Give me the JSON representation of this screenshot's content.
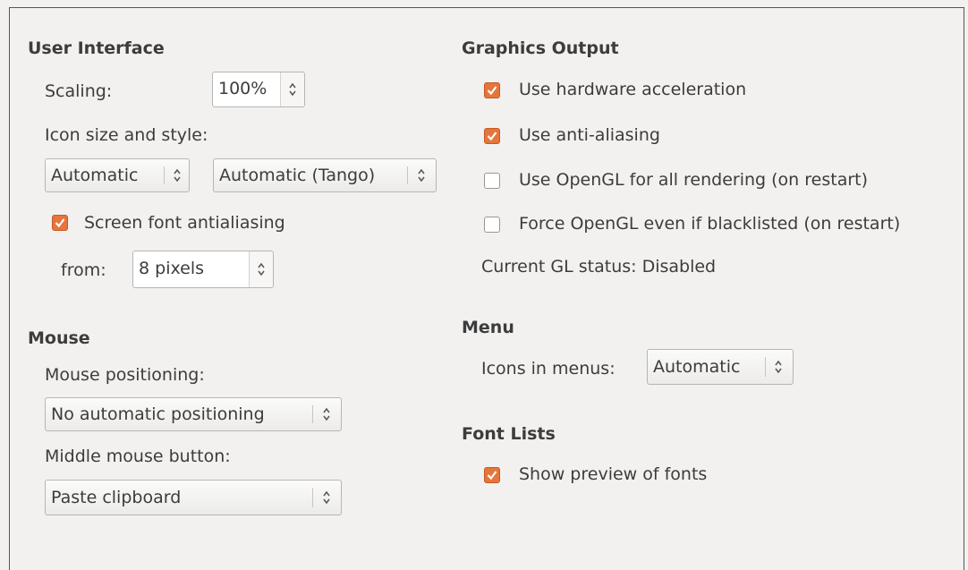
{
  "user_interface": {
    "heading": "User Interface",
    "scaling_label": "Scaling:",
    "scaling_value": "100%",
    "icon_label": "Icon size and style:",
    "icon_size_value": "Automatic",
    "icon_style_value": "Automatic (Tango)",
    "antialias_label": "Screen font antialiasing",
    "antialias_checked": true,
    "from_label": "from:",
    "from_value": "8 pixels"
  },
  "mouse": {
    "heading": "Mouse",
    "positioning_label": "Mouse positioning:",
    "positioning_value": "No automatic positioning",
    "middle_label": "Middle mouse button:",
    "middle_value": "Paste clipboard"
  },
  "graphics": {
    "heading": "Graphics Output",
    "hw_accel_label": "Use hardware acceleration",
    "hw_accel_checked": true,
    "anti_alias_label": "Use anti-aliasing",
    "anti_alias_checked": true,
    "opengl_label": "Use OpenGL for all rendering (on restart)",
    "opengl_checked": false,
    "force_opengl_label": "Force OpenGL even if blacklisted (on restart)",
    "force_opengl_checked": false,
    "gl_status": "Current GL status: Disabled"
  },
  "menu": {
    "heading": "Menu",
    "icons_label": "Icons in menus:",
    "icons_value": "Automatic"
  },
  "font_lists": {
    "heading": "Font Lists",
    "preview_label": "Show preview of fonts",
    "preview_checked": true
  },
  "colors": {
    "accent": "#e5753b",
    "background": "#f2f1f0"
  }
}
